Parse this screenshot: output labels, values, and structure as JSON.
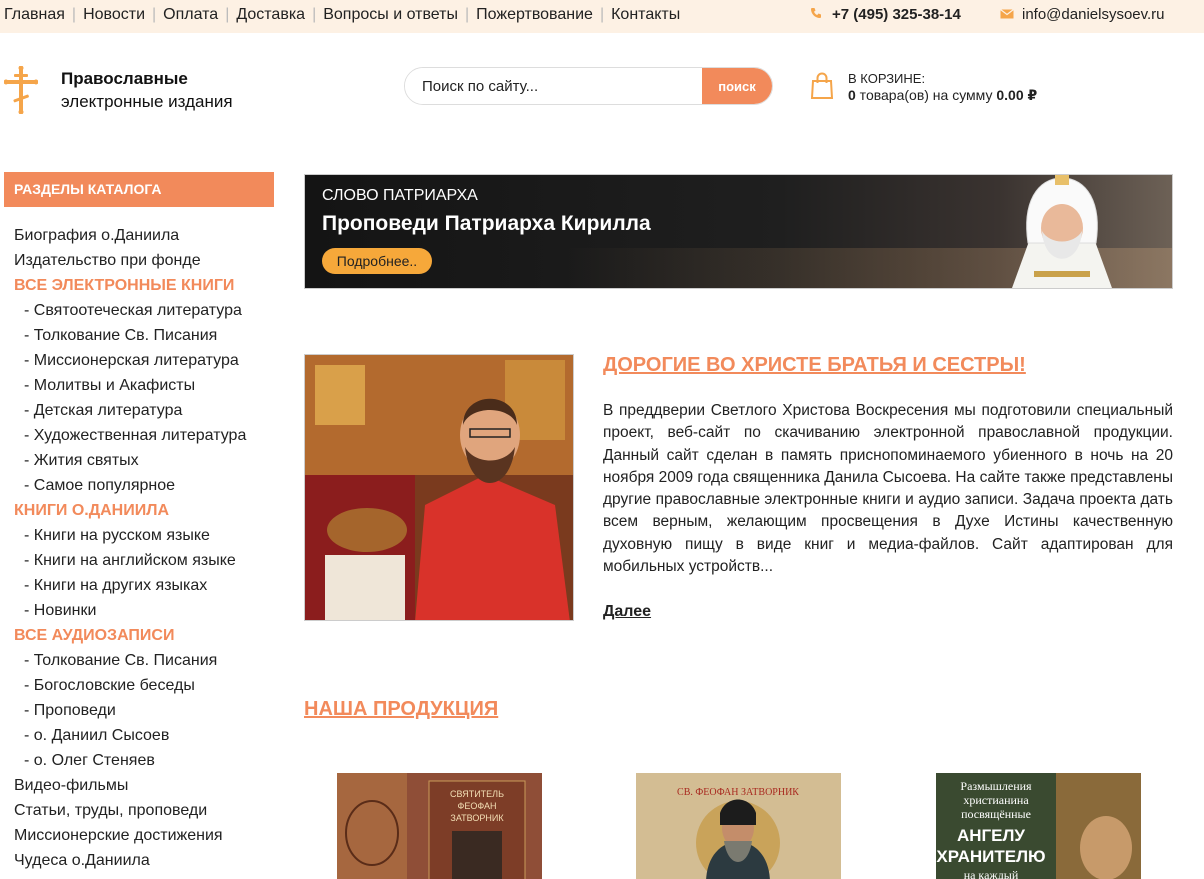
{
  "topnav": {
    "items": [
      "Главная",
      "Новости",
      "Оплата",
      "Доставка",
      "Вопросы и ответы",
      "Пожертвование",
      "Контакты"
    ],
    "phone": "+7 (495) 325-38-14",
    "email": "info@danielsysoev.ru"
  },
  "logo": {
    "title": "Православные",
    "subtitle": "электронные издания"
  },
  "search": {
    "placeholder": "Поиск по сайту...",
    "button_label": "поиск"
  },
  "cart": {
    "label": "В КОРЗИНЕ:",
    "count": "0",
    "count_suffix": " товара(ов) на сумму ",
    "sum": "0.00 ₽"
  },
  "sidebar": {
    "heading": "РАЗДЕЛЫ КАТАЛОГА",
    "items": [
      {
        "label": "Биография о.Даниила",
        "kind": "item"
      },
      {
        "label": "Издательство при фонде",
        "kind": "item"
      },
      {
        "label": "ВСЕ ЭЛЕКТРОННЫЕ КНИГИ",
        "kind": "cat"
      },
      {
        "label": "- Святоотеческая литература",
        "kind": "sub"
      },
      {
        "label": "- Толкование Св. Писания",
        "kind": "sub"
      },
      {
        "label": "- Миссионерская литература",
        "kind": "sub"
      },
      {
        "label": "- Молитвы и Акафисты",
        "kind": "sub"
      },
      {
        "label": "- Детская литература",
        "kind": "sub"
      },
      {
        "label": "- Художественная литература",
        "kind": "sub"
      },
      {
        "label": "- Жития святых",
        "kind": "sub"
      },
      {
        "label": "- Самое популярное",
        "kind": "sub"
      },
      {
        "label": "КНИГИ О.ДАНИИЛА",
        "kind": "cat"
      },
      {
        "label": "- Книги на русском языке",
        "kind": "sub"
      },
      {
        "label": "- Книги на английском языке",
        "kind": "sub"
      },
      {
        "label": "- Книги на других языках",
        "kind": "sub"
      },
      {
        "label": "- Новинки",
        "kind": "sub"
      },
      {
        "label": "ВСЕ АУДИОЗАПИСИ",
        "kind": "cat"
      },
      {
        "label": "- Толкование Св. Писания",
        "kind": "sub"
      },
      {
        "label": "- Богословские беседы",
        "kind": "sub"
      },
      {
        "label": "- Проповеди",
        "kind": "sub"
      },
      {
        "label": "- о. Даниил Сысоев",
        "kind": "sub"
      },
      {
        "label": "- о. Олег Стеняев",
        "kind": "sub"
      },
      {
        "label": "Видео-фильмы",
        "kind": "item"
      },
      {
        "label": "Статьи, труды, проповеди",
        "kind": "item"
      },
      {
        "label": "Миссионерские достижения",
        "kind": "item"
      },
      {
        "label": "Чудеса о.Даниила",
        "kind": "item"
      }
    ]
  },
  "banner": {
    "kicker": "СЛОВО ПАТРИАРХА",
    "title": "Проповеди Патриарха Кирилла",
    "button_label": "Подробнее.."
  },
  "article": {
    "title": "ДОРОГИЕ ВО ХРИСТЕ БРАТЬЯ И СЕСТРЫ!",
    "body": "В преддверии Светлого Христова Воскресения мы подготовили специальный проект, веб-сайт по скачиванию электронной православной продукции. Данный сайт сделан в память приснопоминаемого убиенного в ночь на 20 ноября 2009 года священника Данила Сысоева. На сайте также представлены другие православные электронные книги и аудио записи. Задача проекта дать всем верным, желающим просвещения в Духе Истины качественную духовную пищу в виде книг и медиа-файлов. Сайт адаптирован для мобильных устройств...",
    "more_label": "Далее"
  },
  "products": {
    "title": "НАША ПРОДУКЦИЯ",
    "items": [
      {
        "cover_lines": [
          "СВЯТИТЕЛЬ",
          "ФЕОФАН",
          "ЗАТВОРНИК"
        ]
      },
      {
        "cover_lines": [
          "СВ. ФЕОФАН ЗАТВОРНИК"
        ]
      },
      {
        "cover_lines": [
          "Размышления",
          "христианина",
          "посвящённые",
          "АНГЕЛУ",
          "ХРАНИТЕЛЮ",
          "на каждый"
        ]
      }
    ]
  },
  "colors": {
    "accent": "#f28a5b",
    "topbar_bg": "#fdf1e4",
    "banner_button": "#f6a83a"
  }
}
